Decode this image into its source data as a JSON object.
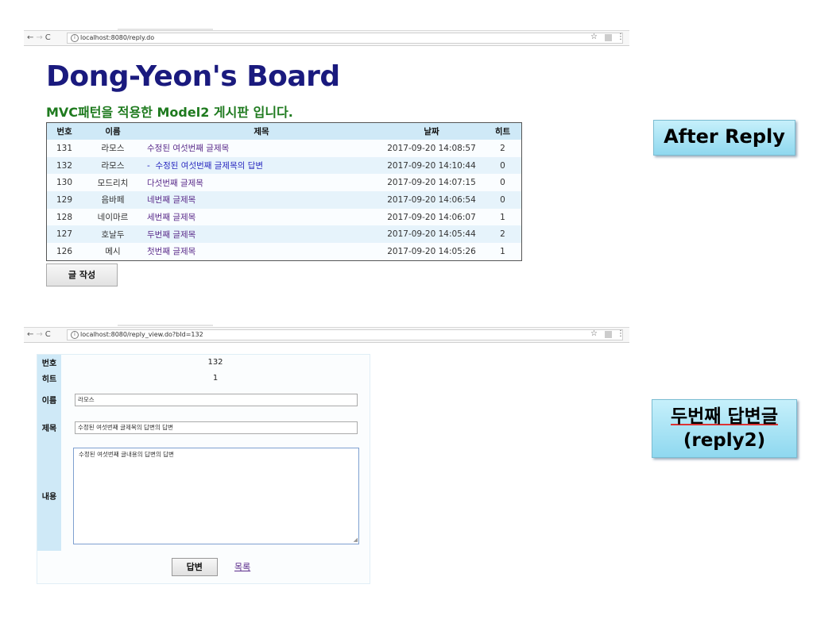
{
  "browser1": {
    "url": "localhost:8080/reply.do"
  },
  "browser2": {
    "url": "localhost:8080/reply_view.do?bId=132"
  },
  "board": {
    "title": "Dong-Yeon's Board",
    "subtitle": "MVC패턴을 적용한 Model2 게시판 입니다.",
    "headers": {
      "no": "번호",
      "name": "이름",
      "subject": "제목",
      "date": "날짜",
      "hit": "히트"
    },
    "rows": [
      {
        "no": "131",
        "name": "라모스",
        "subject": "수정된 여섯번째 글제목",
        "date": "2017-09-20 14:08:57",
        "hit": "2"
      },
      {
        "no": "132",
        "name": "라모스",
        "subject": "-  수정된 여섯번째 글제목의 답변",
        "date": "2017-09-20 14:10:44",
        "hit": "0"
      },
      {
        "no": "130",
        "name": "모드리치",
        "subject": "다섯번째 글제목",
        "date": "2017-09-20 14:07:15",
        "hit": "0"
      },
      {
        "no": "129",
        "name": "음바페",
        "subject": "네번째 글제목",
        "date": "2017-09-20 14:06:54",
        "hit": "0"
      },
      {
        "no": "128",
        "name": "네이마르",
        "subject": "세번째 글제목",
        "date": "2017-09-20 14:06:07",
        "hit": "1"
      },
      {
        "no": "127",
        "name": "호날두",
        "subject": "두번째 글제목",
        "date": "2017-09-20 14:05:44",
        "hit": "2"
      },
      {
        "no": "126",
        "name": "메시",
        "subject": "첫번째 글제목",
        "date": "2017-09-20 14:05:26",
        "hit": "1"
      }
    ],
    "write_button": "글 작성"
  },
  "callouts": {
    "after_reply": "After Reply",
    "second_reply_line1": "두번째 답변글",
    "second_reply_line2": "(reply2)"
  },
  "reply_view": {
    "labels": {
      "no": "번호",
      "hit": "히트",
      "name": "이름",
      "subject": "제목",
      "content": "내용"
    },
    "no": "132",
    "hit": "1",
    "name": "라모스",
    "subject": "수정된 여섯번째 글제목의 답변의 답변",
    "content": "수정된 여섯번째 글내용의 답변의 답변",
    "reply_button": "답변",
    "list_link": "목록"
  }
}
